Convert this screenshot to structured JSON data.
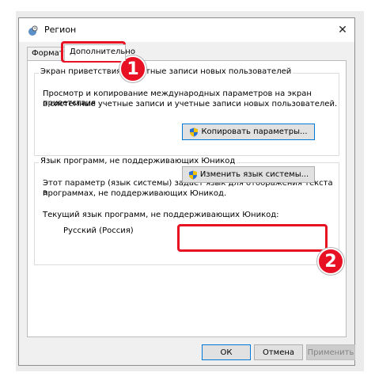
{
  "window": {
    "title": "Регион",
    "close_glyph": "✕"
  },
  "tabs": [
    {
      "label": "Форматы"
    },
    {
      "label": "Дополнительно"
    }
  ],
  "welcome_group": {
    "legend": "Экран приветствия и учетные записи новых пользователей",
    "description_line1": "Просмотр и копирование международных параметров на экран приветствия",
    "description_line2": "в системные учетные записи и учетные записи новых пользователей.",
    "copy_button_label": "Копировать параметры...",
    "button_icon": "uac-shield-icon"
  },
  "unicode_group": {
    "legend": "Язык программ, не поддерживающих Юникод",
    "description_line1": "Этот параметр (язык системы) задает язык для отображения текста в",
    "description_line2": "программах, не поддерживающих Юникод.",
    "current_label": "Текущий язык программ, не поддерживающих Юникод:",
    "current_value": "Русский (Россия)",
    "change_button_label": "Изменить язык системы...",
    "button_icon": "uac-shield-icon"
  },
  "footer": {
    "ok_label": "ОК",
    "cancel_label": "Отмена",
    "apply_label": "Применить",
    "apply_enabled": false
  },
  "annotations": {
    "badge1": "1",
    "badge2": "2",
    "color": "#e81123"
  }
}
